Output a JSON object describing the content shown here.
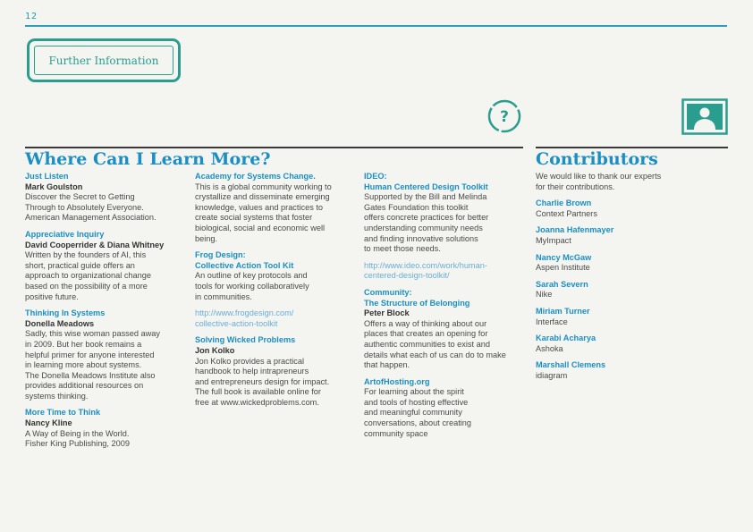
{
  "page_number": "12",
  "badge": "Further Information",
  "icons": {
    "question": "question-mark-icon",
    "contributor": "person-icon"
  },
  "colors": {
    "accent_blue": "#1b8fc4",
    "teal": "#2a9d8f",
    "link": "#6aaed6"
  },
  "main": {
    "heading": "Where Can I Learn More?",
    "col1": [
      {
        "title": "Just Listen",
        "author": "Mark Goulston",
        "body": "Discover the Secret to Getting\nThrough to Absolutely Everyone.\nAmerican Management Association."
      },
      {
        "title": "Appreciative Inquiry",
        "author": "David Cooperrider & Diana Whitney",
        "body": "Written by the founders of AI, this\nshort, practical guide offers an\napproach to organizational change\nbased on the possibility of a more\npositive future."
      },
      {
        "title": "Thinking In Systems",
        "author": "Donella Meadows",
        "body": "Sadly, this wise woman passed away\nin 2009. But her book remains a\nhelpful primer for anyone interested\nin learning more about systems.\nThe Donella Meadows Institute also\nprovides additional resources on\nsystems thinking."
      },
      {
        "title": "More Time to Think",
        "author": "Nancy Kline",
        "body": "A Way of Being in the World.\nFisher King Publishing, 2009"
      }
    ],
    "col2": [
      {
        "title": "Academy for Systems Change.",
        "body": "This is a global community working to\ncrystallize and disseminate emerging\nknowledge, values and practices to\ncreate social systems that foster\nbiological, social and economic well\nbeing."
      },
      {
        "title": "Frog Design:\nCollective Action Tool Kit",
        "body": "An outline of key protocols and\ntools for working collaboratively\nin communities."
      },
      {
        "link": "http://www.frogdesign.com/\ncollective-action-toolkit"
      },
      {
        "title": "Solving Wicked Problems",
        "author": "Jon Kolko",
        "body": "Jon Kolko provides a practical\nhandbook to help intrapreneurs\nand entrepreneurs design for impact.\nThe full book is available online for\nfree at www.wickedproblems.com."
      }
    ],
    "col3": [
      {
        "title": "IDEO:\nHuman Centered Design Toolkit",
        "body": "Supported by the Bill and Melinda\nGates Foundation this toolkit\noffers concrete practices for better\nunderstanding community needs\nand finding innovative solutions\nto meet those needs."
      },
      {
        "link": "http://www.ideo.com/work/human-\ncentered-design-toolkit/"
      },
      {
        "title": "Community:\nThe Structure of Belonging",
        "author": "Peter Block",
        "body": "Offers a way of thinking about our\nplaces that creates an opening for\nauthentic communities to exist and\ndetails what each of us can do to make\nthat happen."
      },
      {
        "title": "ArtofHosting.org",
        "body": "For learning about the spirit\nand tools of hosting effective\nand meaningful community\nconversations, about creating\ncommunity space"
      }
    ]
  },
  "contributors": {
    "heading": "Contributors",
    "intro": "We would like to thank our experts\nfor their contributions.",
    "people": [
      {
        "name": "Charlie Brown",
        "org": "Context Partners"
      },
      {
        "name": "Joanna Hafenmayer",
        "org": "MyImpact"
      },
      {
        "name": "Nancy McGaw",
        "org": "Aspen Institute"
      },
      {
        "name": "Sarah Severn",
        "org": "Nike"
      },
      {
        "name": "Miriam Turner",
        "org": "Interface"
      },
      {
        "name": "Karabi Acharya",
        "org": "Ashoka"
      },
      {
        "name": "Marshall Clemens",
        "org": "idiagram"
      }
    ]
  }
}
